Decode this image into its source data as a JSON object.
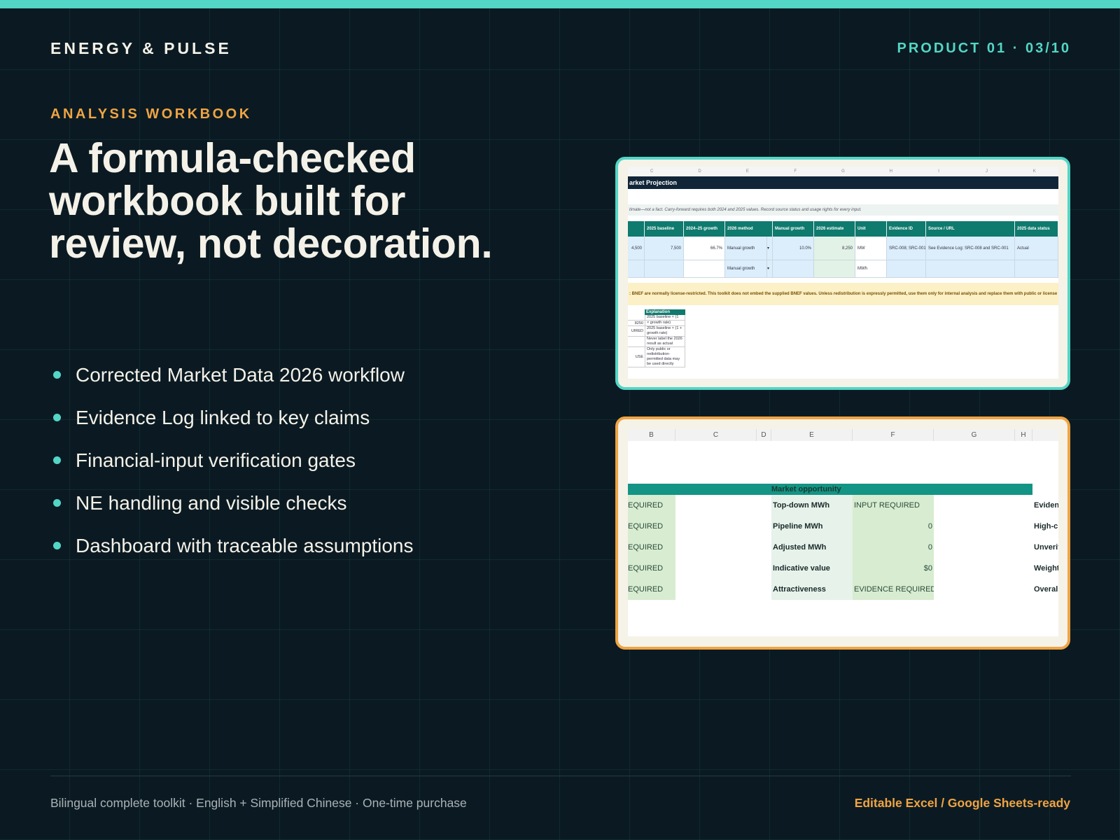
{
  "brand": "ENERGY & PULSE",
  "counter": "PRODUCT 01 · 03/10",
  "eyebrow": "ANALYSIS WORKBOOK",
  "headline": "A formula-checked workbook built for review, not decoration.",
  "features": [
    "Corrected Market Data 2026 workflow",
    "Evidence Log linked to key claims",
    "Financial-input verification gates",
    "NE handling and visible checks",
    "Dashboard with traceable assumptions"
  ],
  "preview_a": {
    "col_letters": [
      "C",
      "D",
      "E",
      "F",
      "G",
      "H",
      "I",
      "J",
      "K"
    ],
    "title": "arket Projection",
    "note": "timate—not a fact. Carry-forward requires both 2024 and 2025 values. Record source status and usage rights for every input.",
    "headers": [
      "",
      "2025 baseline",
      "2024–25 growth",
      "2026 method",
      "Manual growth",
      "2026 estimate",
      "Unit",
      "Evidence ID",
      "Source / URL",
      "2025 data status"
    ],
    "row1": [
      "4,500",
      "7,500",
      "66.7%",
      "Manual growth",
      "▾",
      "10.0%",
      "8,250",
      "MW",
      "SRC-008; SRC-001",
      "See Evidence Log: SRC-008 and SRC-001",
      "Actual"
    ],
    "row2": [
      "",
      "",
      "",
      "Manual growth",
      "▾",
      "",
      "",
      "MWh",
      "",
      "",
      ""
    ],
    "warning": ": BNEF are normally license-restricted. This toolkit does not embed the supplied BNEF values. Unless redistribution is expressly permitted, use them only for internal analysis and replace them with public or license",
    "expl_header": "Explanation",
    "expl_rows": [
      {
        "key": "",
        "text": "2025 baseline × (1"
      },
      {
        "key": "8250",
        "text": "× growth rate)"
      },
      {
        "key": "UIRED",
        "text": "2025 baseline × (1 + growth rate)"
      },
      {
        "key": "",
        "text": "Never label the 2026 result as actual"
      },
      {
        "key": "USE",
        "text": "Only public or redistribution-permitted data may be used directly"
      }
    ]
  },
  "preview_b": {
    "col_letters": [
      "B",
      "C",
      "D",
      "E",
      "F",
      "G",
      "H"
    ],
    "band_label": "Market opportunity",
    "left_cells": [
      "EQUIRED",
      "EQUIRED",
      "EQUIRED",
      "EQUIRED",
      "EQUIRED"
    ],
    "labels": [
      "Top-down MWh",
      "Pipeline MWh",
      "Adjusted MWh",
      "Indicative value",
      "Attractiveness"
    ],
    "values": [
      "INPUT REQUIRED",
      "0",
      "0",
      "$0",
      "EVIDENCE REQUIRED"
    ],
    "right_cells": [
      "Eviden",
      "High-c",
      "Unverif",
      "Weight",
      "Overall"
    ]
  },
  "footer": {
    "left": "Bilingual complete toolkit · English + Simplified Chinese · One-time purchase",
    "right": "Editable Excel / Google Sheets-ready"
  },
  "colors": {
    "background": "#0b1a22",
    "teal": "#53d6c6",
    "amber": "#f0a443",
    "text": "#f4f1e8"
  }
}
